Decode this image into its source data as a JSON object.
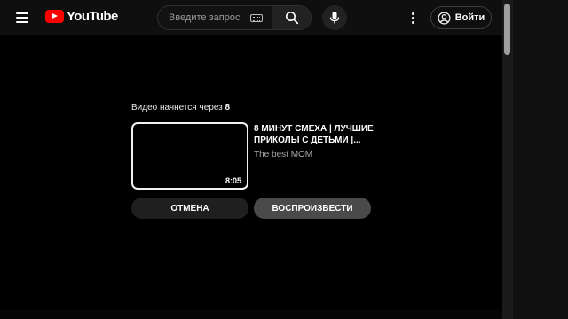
{
  "header": {
    "logo_text": "YouTube",
    "search": {
      "placeholder": "Введите запрос"
    },
    "signin_label": "Войти"
  },
  "icons": {
    "menu": "hamburger-menu-icon",
    "search": "search-icon",
    "keyboard": "keyboard-icon",
    "mic": "microphone-icon",
    "more": "more-vert-icon",
    "account": "account-circle-icon"
  },
  "autoplay": {
    "countdown_prefix": "Видео начнется через",
    "countdown_seconds": "8",
    "video": {
      "title": "8 МИНУТ СМЕХА | ЛУЧШИЕ ПРИКОЛЫ С ДЕТЬМИ |...",
      "channel": "The best MOM",
      "duration": "8:05"
    },
    "cancel_label": "ОТМЕНА",
    "play_label": "ВОСПРОИЗВЕСТИ"
  },
  "colors": {
    "brand_red": "#ff0000",
    "background": "#000000",
    "header_bg": "#0f0f0f"
  }
}
